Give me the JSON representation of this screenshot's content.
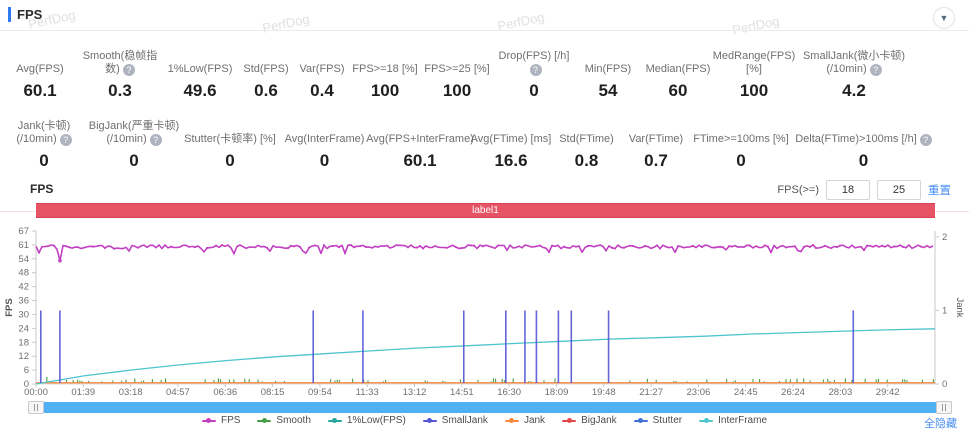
{
  "header": {
    "title": "FPS"
  },
  "watermark": "PerfDog",
  "stats": {
    "row1": [
      {
        "label": "Avg(FPS)",
        "value": "60.1",
        "help": false
      },
      {
        "label": "Smooth(稳帧指数)",
        "value": "0.3",
        "help": true
      },
      {
        "label": "1%Low(FPS)",
        "value": "49.6",
        "help": false
      },
      {
        "label": "Std(FPS)",
        "value": "0.6",
        "help": false
      },
      {
        "label": "Var(FPS)",
        "value": "0.4",
        "help": false
      },
      {
        "label": "FPS>=18 [%]",
        "value": "100",
        "help": false
      },
      {
        "label": "FPS>=25 [%]",
        "value": "100",
        "help": false
      },
      {
        "label": "Drop(FPS) [/h]",
        "value": "0",
        "help": true
      },
      {
        "label": "Min(FPS)",
        "value": "54",
        "help": false
      },
      {
        "label": "Median(FPS)",
        "value": "60",
        "help": false
      },
      {
        "label": "MedRange(FPS)[%]",
        "value": "100",
        "help": false
      },
      {
        "label": "SmallJank(微小卡顿)\n(/10min)",
        "value": "4.2",
        "help": true
      }
    ],
    "row2": [
      {
        "label": "Jank(卡顿)\n(/10min)",
        "value": "0",
        "help": true
      },
      {
        "label": "BigJank(严重卡顿)\n(/10min)",
        "value": "0",
        "help": true
      },
      {
        "label": "Stutter(卡顿率) [%]",
        "value": "0",
        "help": false
      },
      {
        "label": "Avg(InterFrame)",
        "value": "0",
        "help": false
      },
      {
        "label": "Avg(FPS+InterFrame)",
        "value": "60.1",
        "help": false
      },
      {
        "label": "Avg(FTime) [ms]",
        "value": "16.6",
        "help": false
      },
      {
        "label": "Std(FTime)",
        "value": "0.8",
        "help": false
      },
      {
        "label": "Var(FTime)",
        "value": "0.7",
        "help": false
      },
      {
        "label": "FTime>=100ms [%]",
        "value": "0",
        "help": false
      },
      {
        "label": "Delta(FTime)>100ms [/h]",
        "value": "0",
        "help": true
      }
    ]
  },
  "chart_section": {
    "title": "FPS",
    "threshold_label": "FPS(>=)",
    "threshold_inputs": [
      "18",
      "25"
    ],
    "reset_label": "重置",
    "hide_all_label": "全隐藏"
  },
  "chart_data": {
    "type": "line",
    "banner": "label1",
    "x_axis": {
      "tick_labels": [
        "00:00",
        "01:39",
        "03:18",
        "04:57",
        "06:36",
        "08:15",
        "09:54",
        "11:33",
        "13:12",
        "14:51",
        "16:30",
        "18:09",
        "19:48",
        "21:27",
        "23:06",
        "24:45",
        "26:24",
        "28:03",
        "29:42"
      ],
      "range_seconds": [
        0,
        1881
      ]
    },
    "left_axis": {
      "label": "FPS",
      "tick_labels": [
        0,
        6,
        12,
        18,
        24,
        30,
        36,
        42,
        48,
        54,
        61,
        67
      ],
      "range": [
        0,
        67
      ]
    },
    "right_axis": {
      "label": "Jank",
      "tick_labels": [
        0,
        1,
        2
      ],
      "range": [
        0,
        2.08
      ]
    },
    "legend": [
      "FPS",
      "Smooth",
      "1%Low(FPS)",
      "SmallJank",
      "Jank",
      "BigJank",
      "Stutter",
      "InterFrame"
    ],
    "legend_colors": [
      "#c23fc2",
      "#43a047",
      "#26a69a",
      "#5456d4",
      "#f5883d",
      "#e04848",
      "#4272d8",
      "#4ec4cd"
    ],
    "series": [
      {
        "name": "FPS",
        "color": "#c23fc2",
        "axis": "left",
        "kind": "noisy-line",
        "approx_base": 60.1,
        "noise_band": [
          58.6,
          61.3
        ],
        "dips": [
          {
            "t_seconds": 50,
            "value": 54
          }
        ]
      },
      {
        "name": "Smooth",
        "color": "#43a047",
        "axis": "left",
        "kind": "sparse-bars",
        "value_range": [
          0,
          3
        ]
      },
      {
        "name": "1%Low(FPS)",
        "color": "#26a69a",
        "axis": "left",
        "kind": "line",
        "visible": false
      },
      {
        "name": "SmallJank",
        "color": "#5456d4",
        "axis": "right",
        "kind": "event-spikes",
        "spike_value": 1,
        "event_times_seconds": [
          10,
          50,
          580,
          684,
          895,
          983,
          1023,
          1047,
          1093,
          1120,
          1198,
          1710
        ]
      },
      {
        "name": "Jank",
        "color": "#f5883d",
        "axis": "right",
        "kind": "constant-line",
        "constant_value": 0
      },
      {
        "name": "BigJank",
        "color": "#e04848",
        "axis": "right",
        "kind": "line",
        "visible": false
      },
      {
        "name": "Stutter",
        "color": "#4272d8",
        "axis": "left",
        "kind": "line",
        "visible": false
      },
      {
        "name": "InterFrame",
        "color": "#4ec4cd",
        "axis": "right",
        "kind": "line",
        "points_seconds_value": [
          [
            0,
            0.0
          ],
          [
            100,
            0.11
          ],
          [
            200,
            0.19
          ],
          [
            300,
            0.26
          ],
          [
            400,
            0.32
          ],
          [
            500,
            0.37
          ],
          [
            600,
            0.41
          ],
          [
            700,
            0.45
          ],
          [
            800,
            0.49
          ],
          [
            900,
            0.52
          ],
          [
            1000,
            0.55
          ],
          [
            1100,
            0.58
          ],
          [
            1200,
            0.61
          ],
          [
            1300,
            0.63
          ],
          [
            1400,
            0.65
          ],
          [
            1500,
            0.68
          ],
          [
            1600,
            0.7
          ],
          [
            1700,
            0.72
          ],
          [
            1800,
            0.74
          ],
          [
            1881,
            0.75
          ]
        ]
      }
    ]
  }
}
